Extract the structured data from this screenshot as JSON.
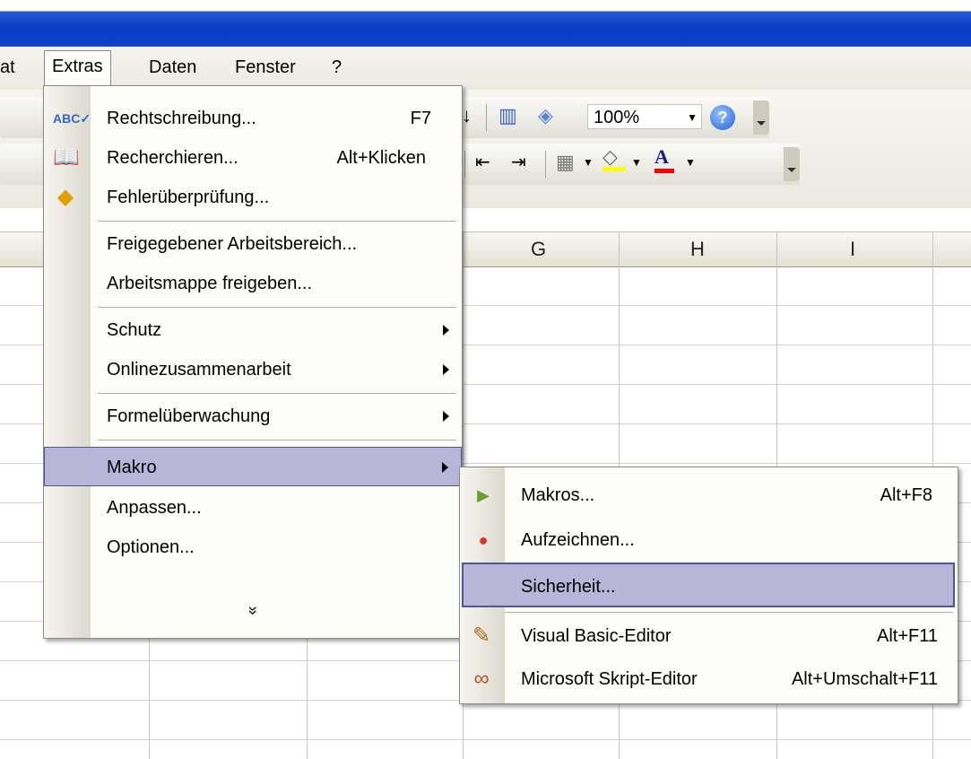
{
  "menubar": {
    "items": [
      {
        "label": "at"
      },
      {
        "label": "Extras"
      },
      {
        "label": "Daten"
      },
      {
        "label": "Fenster"
      },
      {
        "label": "?"
      }
    ]
  },
  "toolbar": {
    "zoom_value": "100%",
    "icons": [
      "sort-icon",
      "chart-wizard-icon",
      "drawing-icon",
      "help-icon",
      "indent-decrease-icon",
      "indent-increase-icon",
      "borders-icon",
      "fill-color-icon",
      "font-color-icon"
    ],
    "fill_color": "#ffff00",
    "font_color": "#ff0000"
  },
  "columns": [
    "G",
    "H",
    "I"
  ],
  "extras_menu": {
    "items": [
      {
        "label": "Rechtschreibung...",
        "shortcut": "F7",
        "icon": "spellcheck-icon"
      },
      {
        "label": "Recherchieren...",
        "shortcut": "Alt+Klicken",
        "icon": "research-icon"
      },
      {
        "label": "Fehlerüberprüfung...",
        "shortcut": "",
        "icon": "error-check-icon"
      },
      {
        "label": "Freigegebener Arbeitsbereich...",
        "shortcut": ""
      },
      {
        "label": "Arbeitsmappe freigeben...",
        "shortcut": ""
      },
      {
        "label": "Schutz",
        "submenu": true
      },
      {
        "label": "Onlinezusammenarbeit",
        "submenu": true
      },
      {
        "label": "Formelüberwachung",
        "submenu": true
      },
      {
        "label": "Makro",
        "submenu": true,
        "highlighted": true
      },
      {
        "label": "Anpassen...",
        "shortcut": ""
      },
      {
        "label": "Optionen...",
        "shortcut": ""
      }
    ],
    "expand_glyph": "»"
  },
  "makro_submenu": {
    "items": [
      {
        "label": "Makros...",
        "shortcut": "Alt+F8",
        "icon": "play-icon"
      },
      {
        "label": "Aufzeichnen...",
        "shortcut": "",
        "icon": "record-icon"
      },
      {
        "label": "Sicherheit...",
        "shortcut": "",
        "highlighted": true
      },
      {
        "label": "Visual Basic-Editor",
        "shortcut": "Alt+F11",
        "icon": "vb-editor-icon"
      },
      {
        "label": "Microsoft Skript-Editor",
        "shortcut": "Alt+Umschalt+F11",
        "icon": "script-editor-icon"
      }
    ]
  },
  "colors": {
    "title_blue": "#0a3cc8",
    "highlight": "#b7b6d9",
    "highlight_border": "#54539a"
  }
}
